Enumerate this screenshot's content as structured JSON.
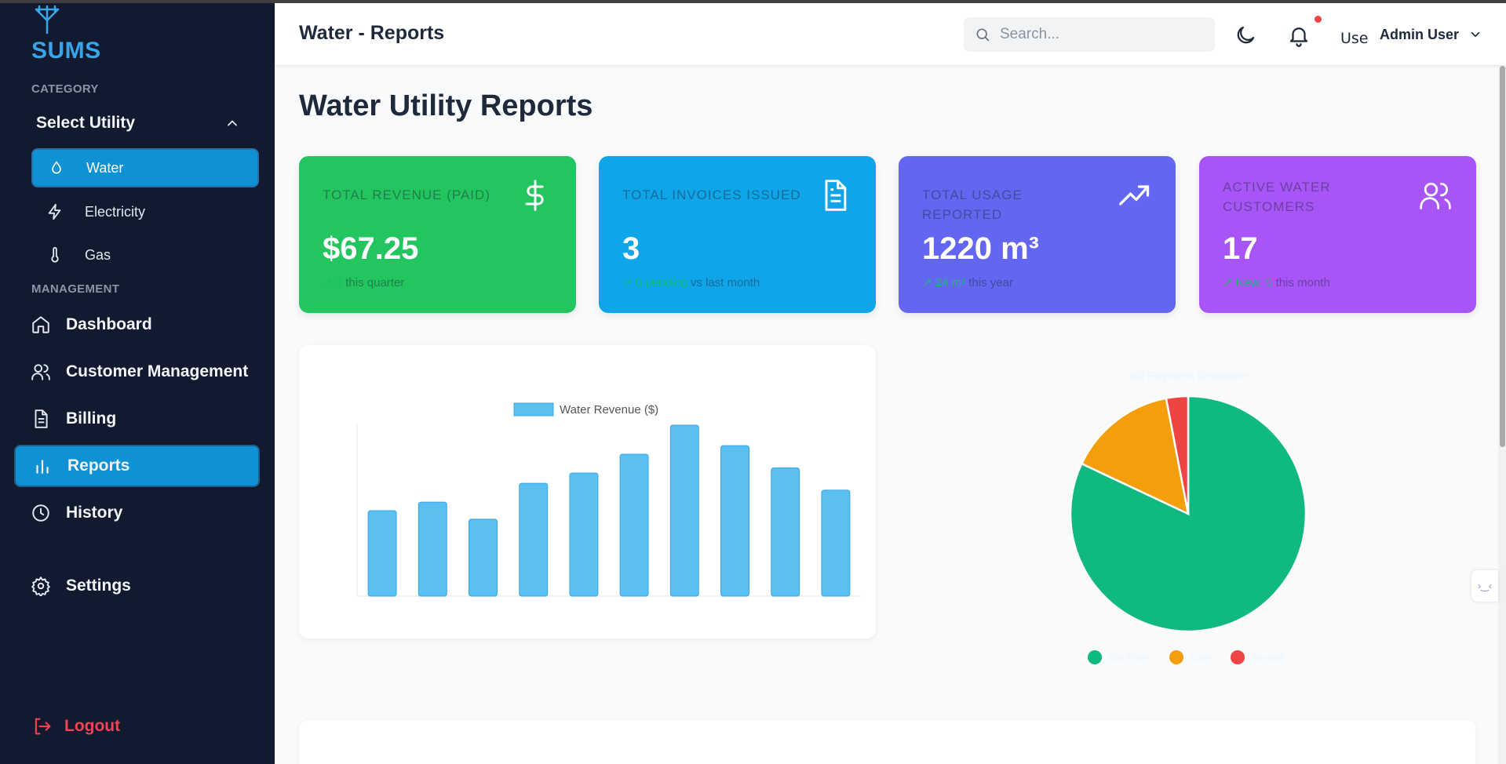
{
  "sidebar": {
    "logo_text": "SUMS",
    "category_label": "CATEGORY",
    "select_utility_label": "Select Utility",
    "utilities": [
      {
        "label": "Water",
        "icon": "droplet-icon",
        "active": true
      },
      {
        "label": "Electricity",
        "icon": "bolt-icon",
        "active": false
      },
      {
        "label": "Gas",
        "icon": "thermometer-icon",
        "active": false
      }
    ],
    "management_label": "MANAGEMENT",
    "nav": [
      {
        "label": "Dashboard",
        "icon": "home-icon",
        "active": false
      },
      {
        "label": "Customer Management",
        "icon": "users-icon",
        "active": false
      },
      {
        "label": "Billing",
        "icon": "document-icon",
        "active": false
      },
      {
        "label": "Reports",
        "icon": "bar-chart-icon",
        "active": true
      },
      {
        "label": "History",
        "icon": "clock-icon",
        "active": false
      },
      {
        "label": "Settings",
        "icon": "gear-icon",
        "active": false
      }
    ],
    "logout_label": "Logout"
  },
  "header": {
    "title": "Water - Reports",
    "search_placeholder": "Search...",
    "avatar_alt": "Use",
    "user_name": "Admin User"
  },
  "main": {
    "title": "Water Utility Reports",
    "cards": [
      {
        "label": "TOTAL REVENUE (PAID)",
        "value": "$67.25",
        "trend": "↗ 3",
        "sub": "this quarter",
        "icon": "dollar-icon",
        "color": "#22c55e"
      },
      {
        "label": "TOTAL INVOICES ISSUED",
        "value": "3",
        "trend": "↗ 0 pending",
        "sub": "vs last month",
        "icon": "file-icon",
        "color": "#0ea5e9"
      },
      {
        "label": "TOTAL USAGE REPORTED",
        "value": "1220 m³",
        "trend": "↗ 24 m³",
        "sub": "this year",
        "icon": "trending-up-icon",
        "color": "#6366f1"
      },
      {
        "label": "ACTIVE WATER CUSTOMERS",
        "value": "17",
        "trend": "↗ New: 5",
        "sub": "this month",
        "icon": "users-icon",
        "color": "#a855f7"
      }
    ]
  },
  "chart_data": [
    {
      "type": "bar",
      "legend": [
        "Water Revenue ($)"
      ],
      "series": [
        {
          "name": "Water Revenue ($)",
          "values": [
            50,
            55,
            45,
            66,
            72,
            83,
            100,
            88,
            75,
            62
          ],
          "color": "#5bc0f0"
        }
      ],
      "categories": [
        "",
        "",
        "",
        "",
        "",
        "",
        "",
        "",
        "",
        ""
      ],
      "ylim": [
        0,
        100
      ],
      "grid": false,
      "legend_position": "top"
    },
    {
      "type": "pie",
      "title": "Bill Payment Discipline",
      "labels": [
        "On Time",
        "Late",
        "Missed"
      ],
      "values": [
        82,
        15,
        3
      ],
      "colors": [
        "#10b981",
        "#f59e0b",
        "#ef4444"
      ],
      "legend_position": "bottom"
    }
  ]
}
